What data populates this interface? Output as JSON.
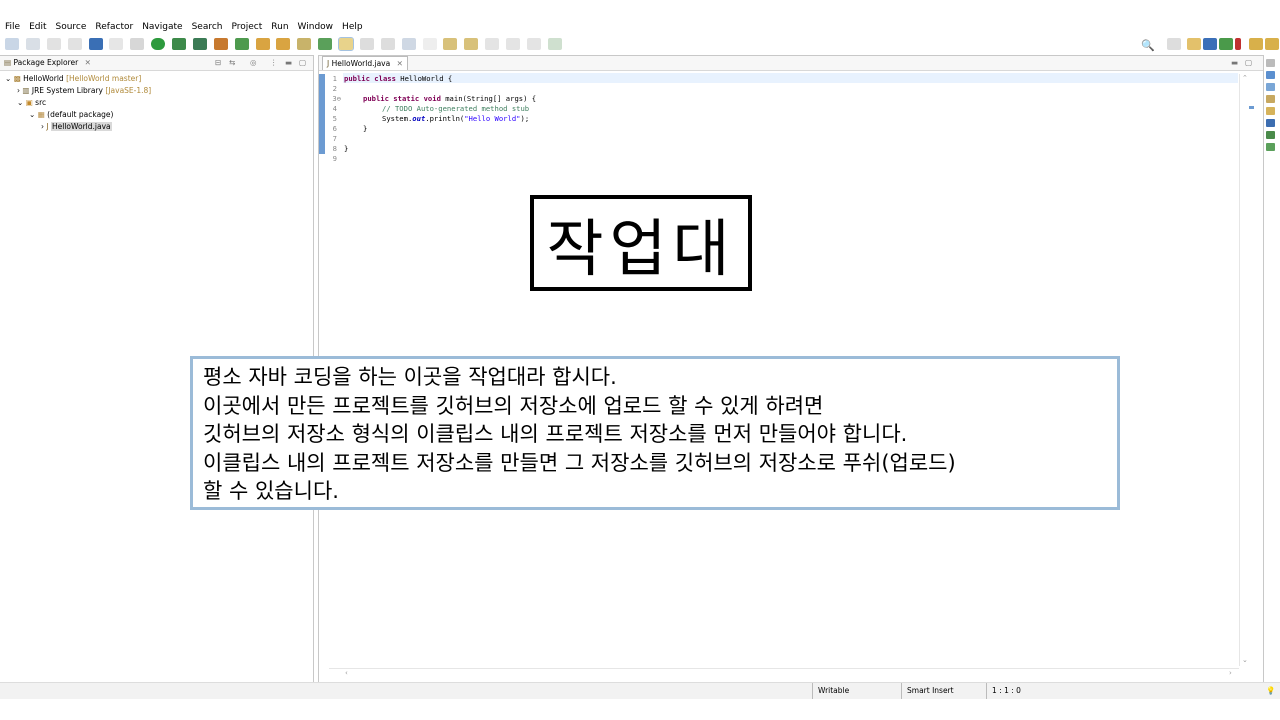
{
  "menu": [
    "File",
    "Edit",
    "Source",
    "Refactor",
    "Navigate",
    "Search",
    "Project",
    "Run",
    "Window",
    "Help"
  ],
  "package_explorer": {
    "tab_label": "Package Explorer",
    "tree": [
      {
        "label": "HelloWorld",
        "decoration": "[HelloWorld master]"
      },
      {
        "label": "JRE System Library",
        "decoration": "[JavaSE-1.8]"
      },
      {
        "label": "src",
        "decoration": ""
      },
      {
        "label": "(default package)",
        "decoration": ""
      },
      {
        "label": "HelloWorld.java",
        "decoration": ""
      }
    ]
  },
  "editor": {
    "tab_label": "HelloWorld.java",
    "line_numbers": [
      "1",
      "2",
      "3⊖",
      "4",
      "5",
      "6",
      "7",
      "8",
      "9"
    ],
    "code": {
      "l1_kw": "public class",
      "l1_rest": " HelloWorld {",
      "l3_kw": "public static void",
      "l3_rest": " main(String[] args) {",
      "l4": "// TODO Auto-generated method stub",
      "l5_a": "System.",
      "l5_b": "out",
      "l5_c": ".println(",
      "l5_d": "\"Hello World\"",
      "l5_e": ");",
      "l6": "}",
      "l8": "}"
    }
  },
  "status": {
    "writable": "Writable",
    "insert_mode": "Smart Insert",
    "position": "1 : 1 : 0"
  },
  "overlay": {
    "title": "작업대",
    "lines": [
      "평소 자바 코딩을 하는 이곳을 작업대라 합시다.",
      "이곳에서 만든 프로젝트를 깃허브의 저장소에 업로드 할 수 있게 하려면",
      "깃허브의 저장소 형식의 이클립스 내의 프로젝트 저장소를 먼저 만들어야 합니다.",
      "이클립스 내의 프로젝트 저장소를 만들면 그 저장소를 깃허브의 저장소로 푸쉬(업로드)",
      "할 수 있습니다."
    ]
  },
  "colors": {
    "accent_border": "#9bbbd8",
    "keyword": "#7f0055",
    "comment": "#3f7f5f",
    "string": "#2a00ff",
    "decoration": "#b08a3a"
  }
}
